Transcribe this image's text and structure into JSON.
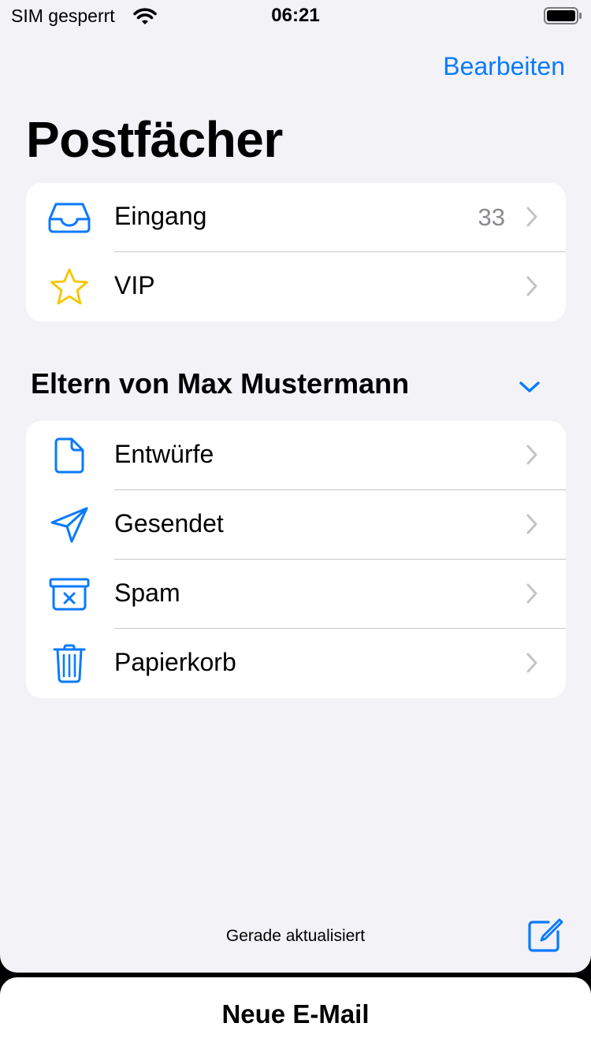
{
  "status_bar": {
    "carrier": "SIM gesperrt",
    "time": "06:21"
  },
  "header": {
    "edit_label": "Bearbeiten",
    "title": "Postfächer"
  },
  "mailboxes": [
    {
      "label": "Eingang",
      "count": "33",
      "icon": "inbox-tray-icon"
    },
    {
      "label": "VIP",
      "count": "",
      "icon": "star-icon"
    }
  ],
  "account": {
    "name": "Eltern von Max Mustermann",
    "folders": [
      {
        "label": "Entwürfe",
        "icon": "document-icon"
      },
      {
        "label": "Gesendet",
        "icon": "paper-plane-icon"
      },
      {
        "label": "Spam",
        "icon": "junk-box-icon"
      },
      {
        "label": "Papierkorb",
        "icon": "trash-icon"
      }
    ]
  },
  "footer": {
    "status": "Gerade aktualisiert"
  },
  "draft_sheet": {
    "title": "Neue E-Mail"
  },
  "colors": {
    "accent": "#0a7aff",
    "vip_star": "#f7c600",
    "background": "#f2f2f7"
  }
}
